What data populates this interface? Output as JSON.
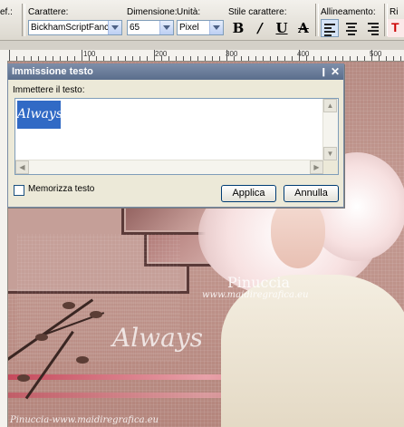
{
  "toolbar": {
    "prev_cut_label": "ef.:",
    "font": {
      "label": "Carattere:",
      "value": "BickhamScriptFanc"
    },
    "size": {
      "label": "Dimensione:",
      "value": "65"
    },
    "units": {
      "label": "Unità:",
      "value": "Pixel"
    },
    "style": {
      "label": "Stile carattere:",
      "bold": "B",
      "italic": "/",
      "underline": "U",
      "strike": "A"
    },
    "alignment": {
      "label": "Allineamento:"
    },
    "extra_label": "Ri"
  },
  "ruler": {
    "labels": [
      "100",
      "200",
      "300",
      "400",
      "500"
    ]
  },
  "dialog": {
    "title": "Immissione testo",
    "pin_icon": "pin-icon",
    "close_icon": "close-icon",
    "prompt": "Immettere il testo:",
    "text_value": "Always",
    "remember_label": "Memorizza testo",
    "apply_label": "Applica",
    "cancel_label": "Annulla"
  },
  "canvas": {
    "watermark_center": "Pinuccia",
    "watermark_url": "www.maidiregrafica.eu",
    "word_art": "Always",
    "watermark_bottom": "Pinuccia-www.maidiregrafica.eu"
  }
}
